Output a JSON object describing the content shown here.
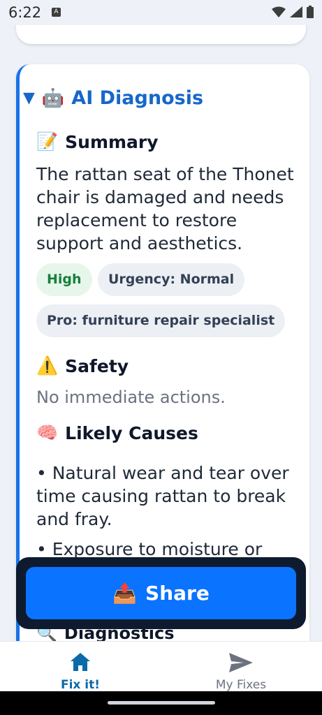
{
  "status_bar": {
    "time": "6:22",
    "notification_letter": "A"
  },
  "diagnosis": {
    "section_title": "AI Diagnosis",
    "collapse_icon": "▼",
    "robot_icon": "🤖",
    "summary": {
      "icon": "📝",
      "heading": "Summary",
      "text": "The rattan seat of the Thonet chair is damaged and needs replacement to restore support and aesthetics."
    },
    "chips": {
      "severity": "High",
      "urgency": "Urgency: Normal",
      "pro": "Pro: furniture repair specialist"
    },
    "safety": {
      "icon": "⚠️",
      "heading": "Safety",
      "text": "No immediate actions."
    },
    "likely_causes": {
      "icon": "🧠",
      "heading": "Likely Causes",
      "items": [
        "• Natural wear and tear over time causing rattan to break and fray.",
        "• Exposure to moisture or"
      ]
    },
    "diagnostics_peek": {
      "icon": "🔍",
      "heading": "Diagnostics"
    }
  },
  "share_button": {
    "icon": "📤",
    "label": "Share"
  },
  "bottom_nav": {
    "items": [
      {
        "label": "Fix it!",
        "active": true
      },
      {
        "label": "My Fixes",
        "active": false
      }
    ]
  },
  "colors": {
    "accent": "#1667c9",
    "share": "#0a73ff",
    "nav_active": "#0b6aa8"
  }
}
